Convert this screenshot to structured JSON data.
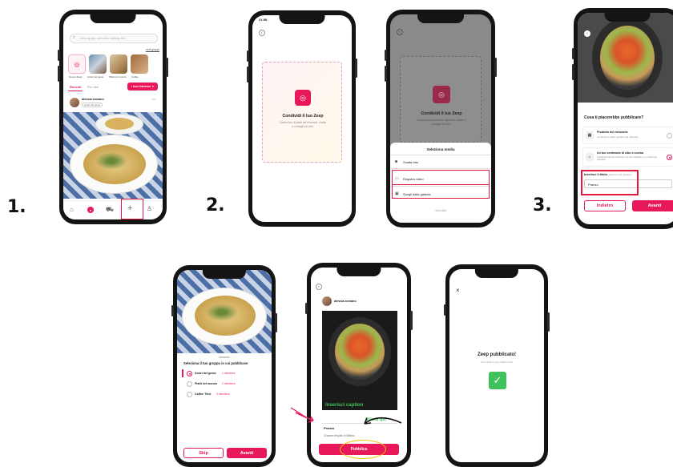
{
  "steps": {
    "s1": "1.",
    "s2": "2.",
    "s3": "3."
  },
  "p1": {
    "search_placeholder": "Cerca gruppi, username, hashtag, titoli",
    "see_all": "vedi gruppi",
    "groups": [
      "Nuovo Zeep",
      "Amici del gusto",
      "Piatti nel mondo",
      "Coffee"
    ],
    "tabs": [
      "Recenti",
      "Più visti"
    ],
    "filter_label": "I tuoi interessi",
    "user": "alessia.romano",
    "group_tag": "Amici del gusto"
  },
  "p2": {
    "title": "Condividi il tuo Zeep",
    "desc": "Carica foto di piatti dei ristoranti, ricette e consigli sul cibo.",
    "time": "21:58"
  },
  "p3": {
    "title": "Condividi il tuo Zeep",
    "desc": "Carica foto di piatti dei ristoranti, ricette e consigli sul cibo.",
    "sheet_title": "Seleziona media",
    "opt1": "Scatta foto",
    "opt2": "Registra video",
    "opt3": "Scegli dalla galleria",
    "cancel": "Annulla"
  },
  "p4": {
    "question": "Cosa ti piacerebbe pubblicare?",
    "opt1_title": "Prodotto del ristorante",
    "opt1_desc": "Condividi un piatto specifico del ristorante",
    "opt2_title": "Un tuo contenuto di cibo o cucina",
    "opt2_desc": "Condividi una tua creazione, un tuo consiglio o un contenuto specifico",
    "title_label": "Inserisci il titolo",
    "title_hint": "(Massimo 35 caratteri)",
    "title_value": "Pranzo",
    "back": "Indietro",
    "next": "Avanti"
  },
  "p5": {
    "title": "Seleziona il tuo gruppo in cui pubblicare",
    "groups": [
      {
        "name": "Amici del gusto",
        "members": "1 members"
      },
      {
        "name": "Piatti nel mondo",
        "members": "2 members"
      },
      {
        "name": "Coffee Time",
        "members": "3 members"
      }
    ],
    "skip": "Skip",
    "next": "Avanti"
  },
  "p6": {
    "user": "alessia.romano",
    "annotation_caption": "Inserisci caption",
    "annotation_click": "Clicca qui",
    "post_title": "Pranzo",
    "caption": "Chicken teriyaki in Milano",
    "publish": "Pubblica"
  },
  "p7": {
    "close": "×",
    "title": "Zeep pubblicato!",
    "sub": "Il tuo Zeep è ora visibile a tutti"
  },
  "colors": {
    "accent": "#e8195a",
    "green": "#3fc25b",
    "highlight": "#e5193f",
    "yellow": "#f2c200"
  }
}
